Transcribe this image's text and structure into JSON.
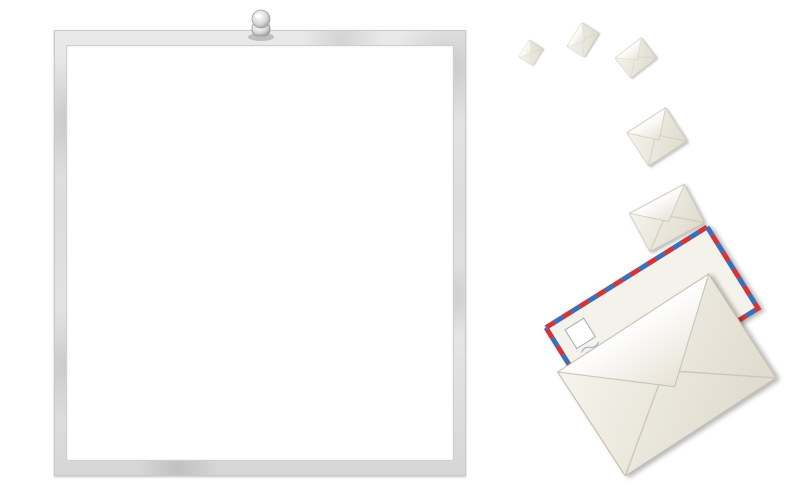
{
  "scene": {
    "frame": {
      "name": "blank-photo-frame"
    },
    "pin": {
      "name": "push-pin-icon"
    },
    "envelopes": [
      {
        "name": "envelope-icon"
      },
      {
        "name": "envelope-icon"
      },
      {
        "name": "envelope-icon"
      },
      {
        "name": "envelope-icon"
      },
      {
        "name": "envelope-icon"
      },
      {
        "name": "airmail-envelope-icon"
      },
      {
        "name": "envelope-icon"
      }
    ],
    "colors": {
      "frame": "#dedede",
      "envelope": "#efece2",
      "airmail_red": "#d0353a",
      "airmail_blue": "#3b6fb6"
    }
  }
}
